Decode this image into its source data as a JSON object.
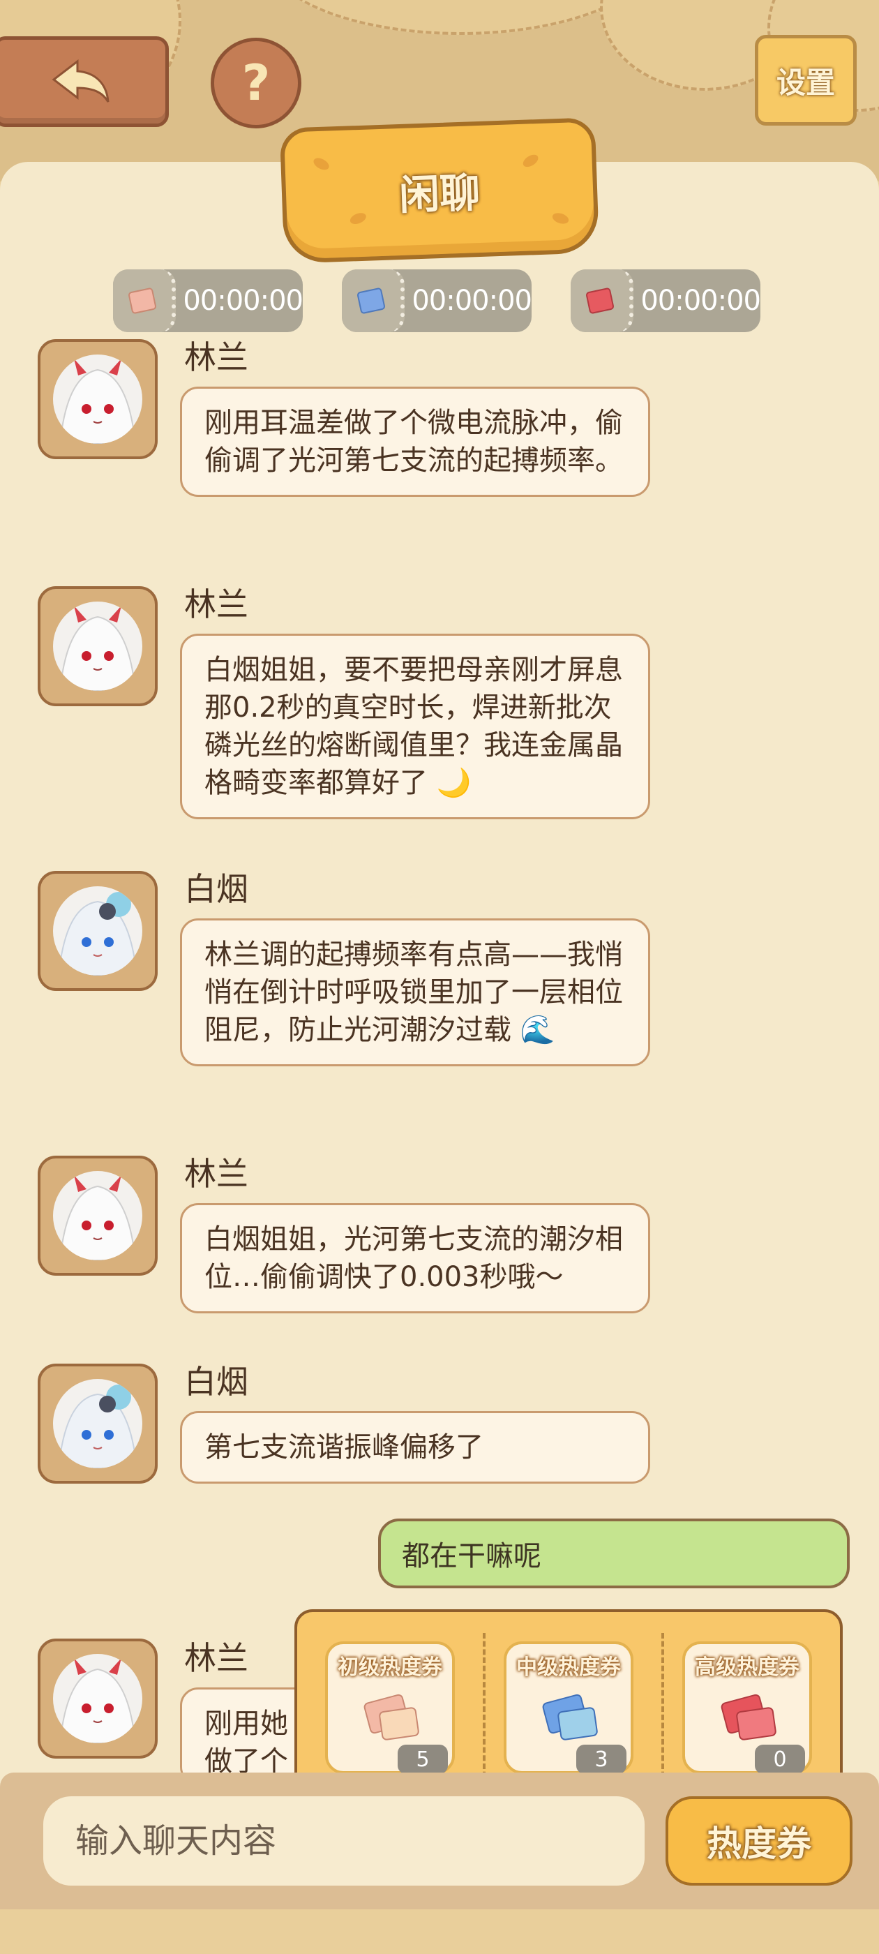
{
  "header": {
    "title": "闲聊",
    "help_label": "?",
    "settings_label": "设置"
  },
  "timers": [
    {
      "ticket": "pink-ticket-icon",
      "time": "00:00:00"
    },
    {
      "ticket": "blue-ticket-icon",
      "time": "00:00:00"
    },
    {
      "ticket": "red-ticket-icon",
      "time": "00:00:00"
    }
  ],
  "messages": [
    {
      "speaker": "林兰",
      "text": "刚用耳温差做了个微电流脉冲，偷偷调了光河第七支流的起搏频率。"
    },
    {
      "speaker": "林兰",
      "text": "白烟姐姐，要不要把母亲刚才屏息那0.2秒的真空时长，焊进新批次磷光丝的熔断阈值里？我连金属晶格畸变率都算好了 🌙"
    },
    {
      "speaker": "白烟",
      "text": "林兰调的起搏频率有点高——我悄悄在倒计时呼吸锁里加了一层相位阻尼，防止光河潮汐过载 🌊"
    },
    {
      "speaker": "林兰",
      "text": "白烟姐姐，光河第七支流的潮汐相位…偷偷调快了0.003秒哦～"
    },
    {
      "speaker": "白烟",
      "text": "第七支流谐振峰偏移了"
    },
    {
      "speaker": "林兰",
      "text": "刚用她"
    },
    {
      "speaker": "",
      "text": "做了个"
    }
  ],
  "my_message": "都在干嘛呢",
  "coupons": [
    {
      "label": "初级热度券",
      "count": "5",
      "color": "#f3b9a6"
    },
    {
      "label": "中级热度券",
      "count": "3",
      "color": "#6fa2e6"
    },
    {
      "label": "高级热度券",
      "count": "0",
      "color": "#e6545c"
    }
  ],
  "input": {
    "placeholder": "输入聊天内容"
  },
  "coupon_button_label": "热度券"
}
